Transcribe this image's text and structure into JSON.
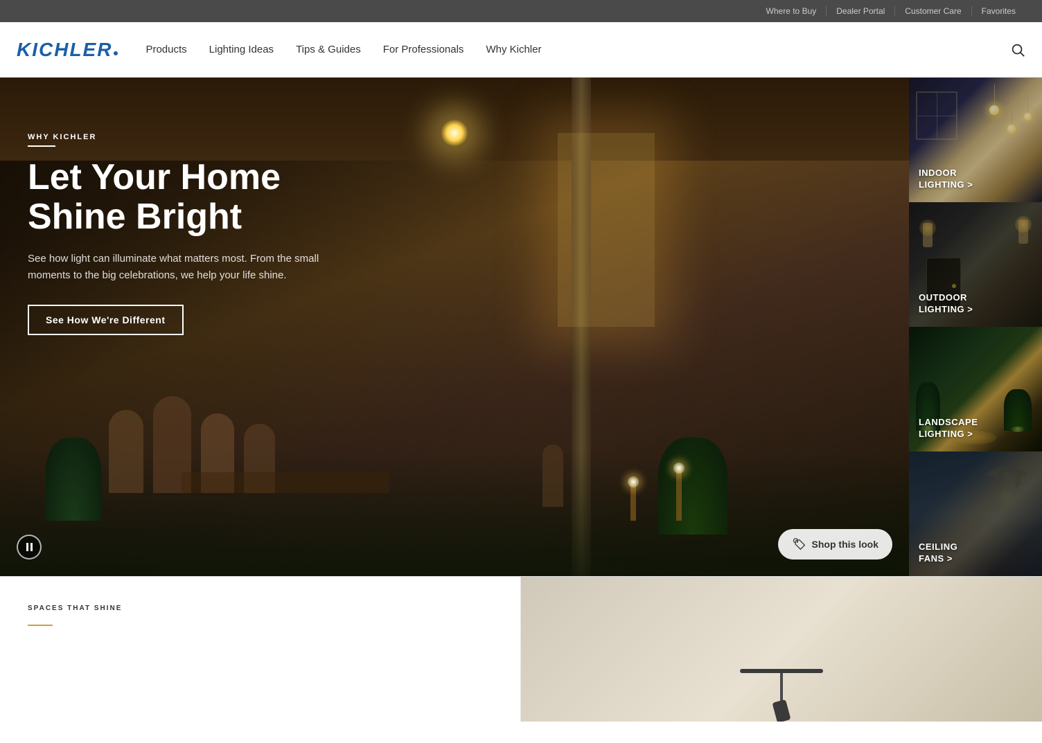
{
  "utility_bar": {
    "links": [
      {
        "id": "where-to-buy",
        "label": "Where to Buy"
      },
      {
        "id": "dealer-portal",
        "label": "Dealer Portal"
      },
      {
        "id": "customer-care",
        "label": "Customer Care"
      },
      {
        "id": "favorites",
        "label": "Favorites"
      }
    ]
  },
  "nav": {
    "logo": "KICHLER",
    "links": [
      {
        "id": "products",
        "label": "Products"
      },
      {
        "id": "lighting-ideas",
        "label": "Lighting Ideas"
      },
      {
        "id": "tips-guides",
        "label": "Tips & Guides"
      },
      {
        "id": "for-professionals",
        "label": "For Professionals"
      },
      {
        "id": "why-kichler",
        "label": "Why Kichler"
      }
    ]
  },
  "hero": {
    "label": "WHY KICHLER",
    "title_line1": "Let Your Home",
    "title_line2": "Shine Bright",
    "subtitle": "See how light can illuminate what matters most. From the small moments to the big celebrations, we help your life shine.",
    "cta_label": "See How We're Different",
    "shop_look_label": "Shop this look"
  },
  "sidebar_panels": [
    {
      "id": "indoor-lighting",
      "label_line1": "INDOOR",
      "label_line2": "LIGHTING >",
      "theme": "indoor"
    },
    {
      "id": "outdoor-lighting",
      "label_line1": "OUTDOOR",
      "label_line2": "LIGHTING >",
      "theme": "outdoor"
    },
    {
      "id": "landscape-lighting",
      "label_line1": "LANDSCAPE",
      "label_line2": "LIGHTING >",
      "theme": "landscape"
    },
    {
      "id": "ceiling-fans",
      "label_line1": "CEILING",
      "label_line2": "FANS >",
      "theme": "ceiling"
    }
  ],
  "bottom": {
    "section_label": "SPACES THAT SHINE"
  }
}
